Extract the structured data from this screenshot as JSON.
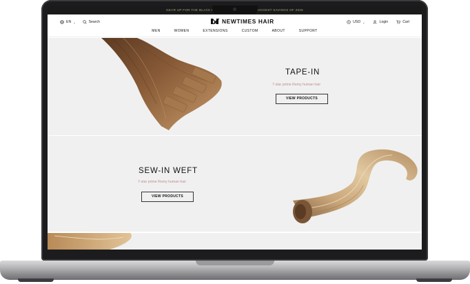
{
  "announcement": "GEAR UP FOR THE BLACK FRIDAY DEALS WITH OUR BIGGEST SAVINGS OF 2025",
  "header": {
    "language": "EN",
    "search_label": "Search",
    "brand": "NEWTIMES HAIR",
    "currency": "USD",
    "login_label": "Login",
    "cart_label": "Cart"
  },
  "nav": [
    "MEN",
    "WOMEN",
    "EXTENSIONS",
    "CUSTOM",
    "ABOUT",
    "SUPPORT"
  ],
  "panels": [
    {
      "title": "TAPE-IN",
      "subtitle": "7-star prime Remy human hair",
      "button": "VIEW PRODUCTS"
    },
    {
      "title": "SEW-IN WEFT",
      "subtitle": "7-star prime Remy human hair",
      "button": "VIEW PRODUCTS"
    }
  ]
}
